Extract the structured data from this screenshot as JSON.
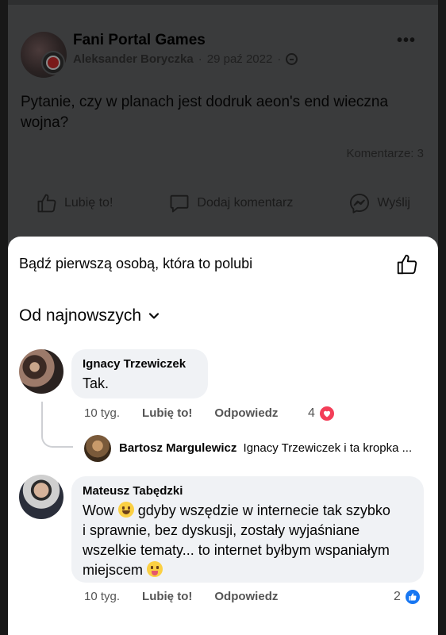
{
  "post": {
    "group_name": "Fani Portal Games",
    "author": "Aleksander Boryczka",
    "separator": "·",
    "date": "29 paź 2022",
    "more_label": "•••",
    "text": "Pytanie, czy w planach jest dodruk aeon's end wieczna wojna?",
    "comments_count": "Komentarze: 3",
    "actions": {
      "like": "Lubię to!",
      "comment": "Dodaj komentarz",
      "send": "Wyślij"
    },
    "visibility_icon": "globe-icon"
  },
  "sheet": {
    "first_like_text": "Bądź pierwszą osobą, która to polubi",
    "sort_label": "Od najnowszych",
    "comments": [
      {
        "name": "Ignacy Trzewiczek",
        "text": "Tak.",
        "time": "10 tyg.",
        "like_label": "Lubię to!",
        "reply_label": "Odpowiedz",
        "reaction_count": "4",
        "reaction": "heart-icon"
      },
      {
        "name": "Bartosz Margulewicz",
        "text": "Ignacy Trzewiczek i ta kropka ..."
      },
      {
        "name": "Mateusz Tabędzki",
        "text_lines": [
          "Wow",
          "gdyby wszędzie w internecie tak szybko",
          "i sprawnie, bez dyskusji, zostały wyjaśniane",
          "wszelkie tematy... to internet byłbym wspaniałym",
          "miejscem"
        ],
        "time": "10 tyg.",
        "like_label": "Lubię to!",
        "reply_label": "Odpowiedz",
        "reaction_count": "2",
        "reaction": "like-icon"
      }
    ]
  },
  "colors": {
    "dim_overlay": "#3a3b3c",
    "bubble": "#f0f2f5",
    "heart": "#f33e58",
    "like_blue": "#1877f2"
  }
}
